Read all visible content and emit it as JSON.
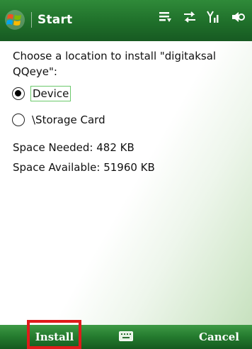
{
  "title_bar": {
    "title": "Start",
    "icons": [
      "windows-flag-icon",
      "network-activity-icon",
      "sync-icon",
      "signal-strength-icon",
      "volume-icon"
    ]
  },
  "content": {
    "prompt": "Choose a location to install \"digitaksal QQeye\":",
    "options": [
      {
        "label": "Device",
        "selected": true
      },
      {
        "label": "\\Storage Card",
        "selected": false
      }
    ],
    "space_needed": "Space Needed:  482 KB",
    "space_available": "Space Available: 51960 KB"
  },
  "soft_keys": {
    "left": "Install",
    "right": "Cancel",
    "center_icon": "keyboard-icon"
  },
  "colors": {
    "title_bar": "#1f6f2a",
    "soft_bar": "#247a2e",
    "highlight": "#e01b1b",
    "focus_border": "#6bc96b"
  }
}
